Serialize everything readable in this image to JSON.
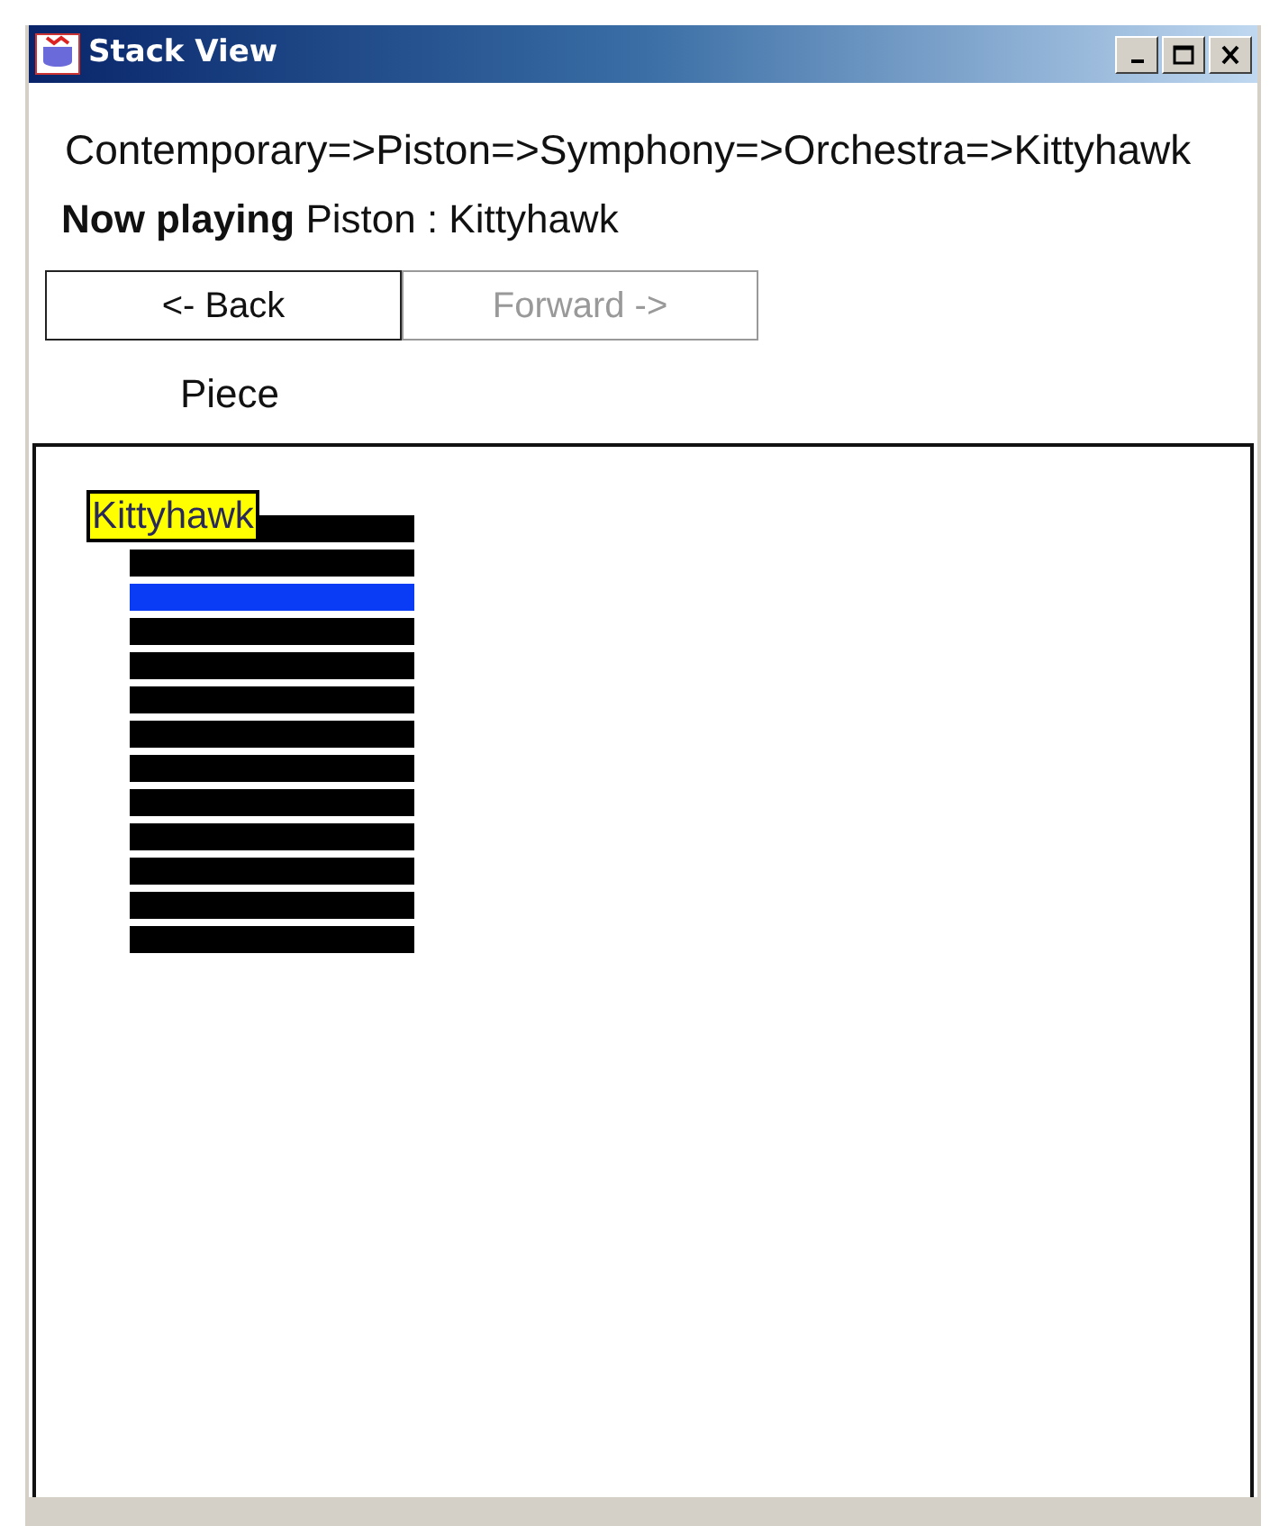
{
  "window": {
    "title": "Stack View"
  },
  "path": "Contemporary=>Piston=>Symphony=>Orchestra=>Kittyhawk",
  "now_playing": {
    "label": "Now playing",
    "value": "Piston : Kittyhawk"
  },
  "buttons": [
    {
      "label": "<- Back",
      "disabled": false
    },
    {
      "label": "Forward ->",
      "disabled": true
    }
  ],
  "column_label": "Piece",
  "stack": {
    "tooltip": "Kittyhawk",
    "items": [
      {
        "selected": false
      },
      {
        "selected": false
      },
      {
        "selected": true
      },
      {
        "selected": false
      },
      {
        "selected": false
      },
      {
        "selected": false
      },
      {
        "selected": false
      },
      {
        "selected": false
      },
      {
        "selected": false
      },
      {
        "selected": false
      },
      {
        "selected": false
      },
      {
        "selected": false
      },
      {
        "selected": false
      }
    ]
  }
}
